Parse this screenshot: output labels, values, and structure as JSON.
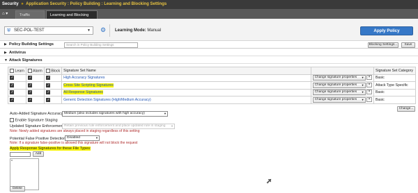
{
  "topbar": {
    "security": "Security",
    "sep1": "»",
    "app_security": "Application Security",
    "sep2": ":",
    "policy_building": "Policy Building",
    "sep3": ":",
    "page": "Learning and Blocking Settings"
  },
  "tabs": {
    "home_icon": "home-icon",
    "traffic_learning": "Traffic Learning",
    "learning_blocking": "Learning and Blocking Settings"
  },
  "policy": {
    "name": "SEC-POL-TEST",
    "learning_mode_label": "Learning Mode:",
    "learning_mode_value": "Manual",
    "apply_button": "Apply Policy"
  },
  "policy_building_settings": {
    "title": "Policy Building Settings",
    "search_placeholder": "Search in Policy Building Settings",
    "blocking_settings_button": "Blocking Settings...",
    "save_button": "Save"
  },
  "sections": {
    "antivirus": "Antivirus",
    "attack_signatures": "Attack Signatures"
  },
  "sig_table": {
    "col_learn": "Learn",
    "col_alarm": "Alarm",
    "col_block": "Block",
    "col_name": "Signature Set Name",
    "col_category": "Signature Set Category",
    "change_props": "Change signature properties",
    "rows": [
      {
        "name": "High Accuracy Signatures",
        "category": "Basic",
        "highlight": false
      },
      {
        "name": "Cross Site Scripting Signatures",
        "category": "Attack Type Specific",
        "highlight": true
      },
      {
        "name": "All Response Signatures",
        "category": "Basic",
        "highlight": true
      },
      {
        "name": "Generic Detection Signatures (High/Medium Accuracy)",
        "category": "Basic",
        "highlight": false
      }
    ],
    "remove_symbol": "×",
    "change_button": "Change..."
  },
  "settings": {
    "auto_added_label": "Auto-Added Signature Accuracy",
    "auto_added_value": "Medium (also includes signatures with high accuracy)",
    "enable_staging": "Enable Signature Staging",
    "updated_enforcement_label": "Updated Signature Enforcement",
    "updated_enforcement_value": "Retain previous rule enforcement and place updated rule in staging",
    "staging_note": "Note: Newly added signatures are always placed in staging regardless of this setting",
    "false_positive_label": "Potential False Positive Detection",
    "false_positive_value": "Disabled",
    "false_positive_note": "Note: If a signature false-positive is allowed this signature will not block the request",
    "apply_response_label": "Apply Response Signatures for these File Types:",
    "add_button": "Add",
    "file_types": [
      "*"
    ],
    "delete_button": "Delete"
  },
  "colors": {
    "topbar": "#3a3a3a",
    "apply_button": "#3678c7",
    "highlight": "#f7f300",
    "link": "#2357b5"
  }
}
